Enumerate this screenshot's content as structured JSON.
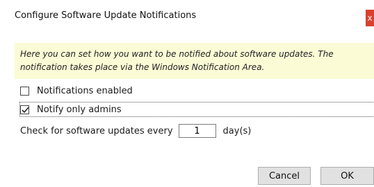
{
  "window": {
    "title": "Configure Software Update Notifications",
    "close_glyph": "x"
  },
  "info": {
    "line1": "Here you can set how you want to be notified about software updates. The",
    "line2": "notification takes place via the Windows Notification Area."
  },
  "options": {
    "notifications_enabled": {
      "label": "Notifications enabled",
      "checked": false
    },
    "notify_only_admins": {
      "label": "Notify only admins",
      "checked": true
    }
  },
  "interval": {
    "label": "Check for software updates every",
    "value": "1",
    "unit": "day(s)"
  },
  "buttons": {
    "cancel": "Cancel",
    "ok": "OK"
  },
  "colors": {
    "info_background": "#fbfbd6",
    "close_button": "#d9412f",
    "button_face": "#e1e1e1"
  }
}
